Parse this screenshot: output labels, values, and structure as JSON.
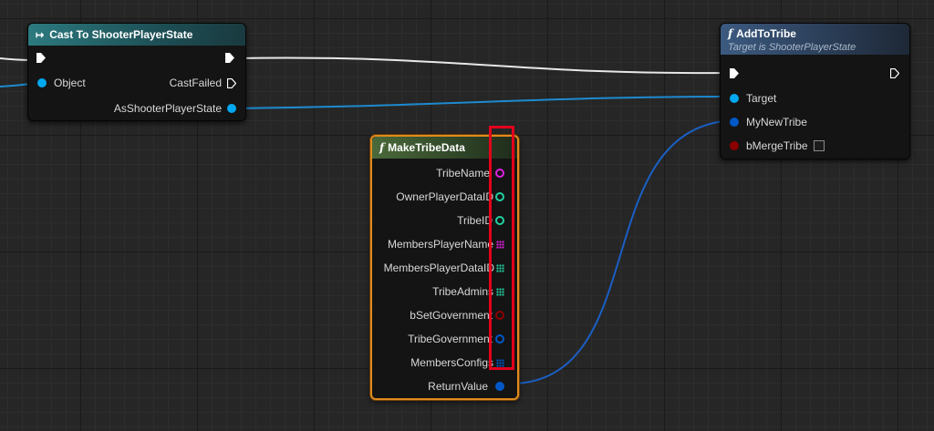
{
  "nodes": {
    "cast": {
      "title": "Cast To ShooterPlayerState",
      "pins": {
        "object": "Object",
        "cast_failed": "CastFailed",
        "as_state": "AsShooterPlayerState"
      }
    },
    "add_to_tribe": {
      "title": "AddToTribe",
      "subtitle": "Target is ShooterPlayerState",
      "pins": {
        "target": "Target",
        "my_new_tribe": "MyNewTribe",
        "b_merge_tribe": "bMergeTribe"
      }
    },
    "make_tribe_data": {
      "title": "MakeTribeData",
      "pins": [
        "TribeName",
        "OwnerPlayerDataID",
        "TribeID",
        "MembersPlayerName",
        "MembersPlayerDataID",
        "TribeAdmins",
        "bSetGovernment",
        "TribeGovernment",
        "MembersConfigs",
        "ReturnValue"
      ]
    }
  },
  "colors": {
    "exec": "#ffffff",
    "object_pin": "#00a8f0",
    "struct_pin": "#0058c8",
    "string_pin": "#e020e0",
    "int_pin": "#20d0a0",
    "bool_pin": "#8c0000",
    "selection": "#e08a1e",
    "highlight_box": "#e3001b"
  }
}
